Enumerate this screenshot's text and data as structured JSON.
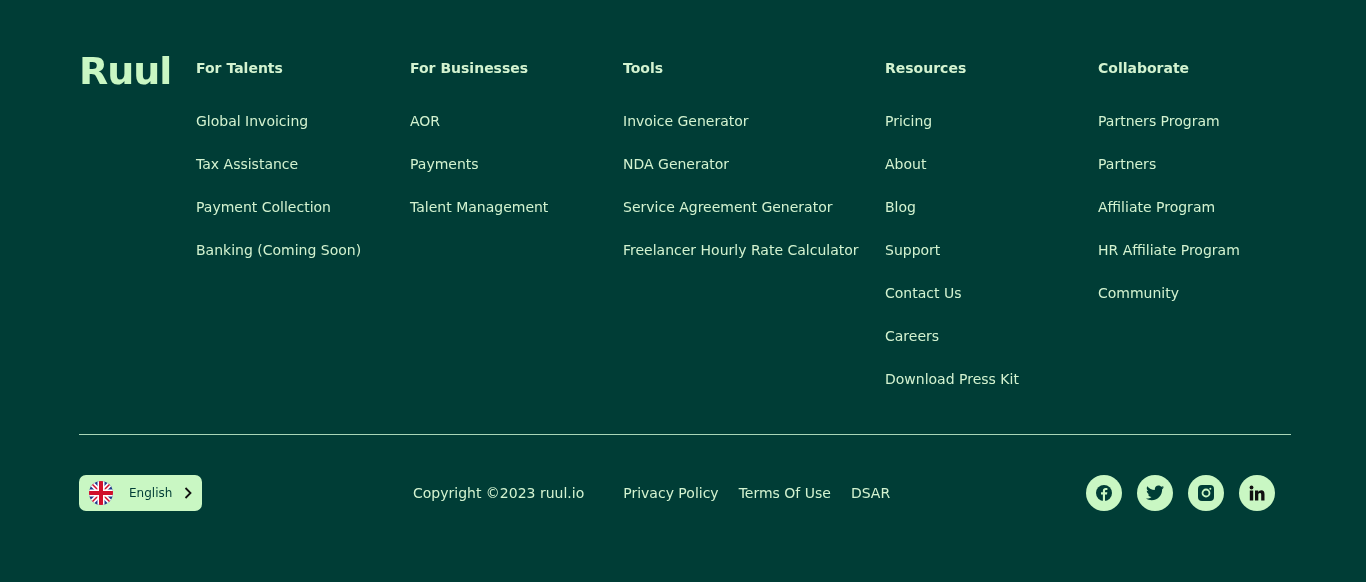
{
  "logo": "Ruul",
  "columns": [
    {
      "heading": "For Talents",
      "links": [
        "Global Invoicing",
        "Tax Assistance",
        "Payment Collection",
        "Banking (Coming Soon)"
      ]
    },
    {
      "heading": "For Businesses",
      "links": [
        "AOR",
        "Payments",
        "Talent Management"
      ]
    },
    {
      "heading": "Tools",
      "links": [
        "Invoice Generator",
        "NDA Generator",
        "Service Agreement Generator",
        "Freelancer Hourly Rate Calculator"
      ]
    },
    {
      "heading": "Resources",
      "links": [
        "Pricing",
        "About",
        "Blog",
        "Support",
        "Contact Us",
        "Careers",
        "Download Press Kit"
      ]
    },
    {
      "heading": "Collaborate",
      "links": [
        "Partners Program",
        "Partners",
        "Affiliate Program",
        "HR Affiliate Program",
        "Community"
      ]
    }
  ],
  "language": {
    "label": "English"
  },
  "copyright": "Copyright ©2023 ruul.io",
  "legal_links": [
    "Privacy Policy",
    "Terms Of Use",
    "DSAR"
  ],
  "socials": [
    {
      "kind": "facebook"
    },
    {
      "kind": "twitter"
    },
    {
      "kind": "instagram"
    },
    {
      "kind": "linkedin"
    }
  ]
}
